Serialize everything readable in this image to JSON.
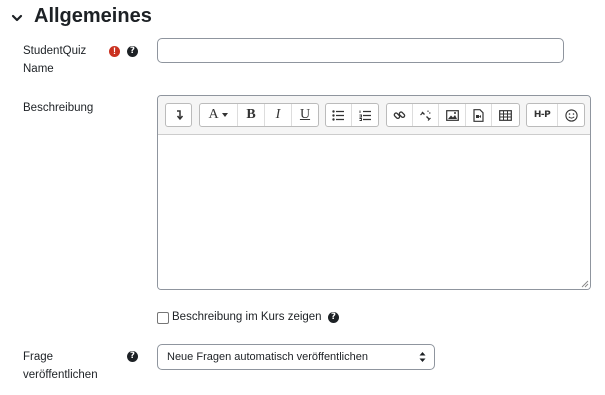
{
  "section": {
    "title": "Allgemeines"
  },
  "fields": {
    "name": {
      "label_line1": "StudentQuiz",
      "label_line2": "Name",
      "value": "",
      "required_symbol": "!",
      "help_symbol": "?"
    },
    "description": {
      "label": "Beschreibung",
      "toolbar": [
        [
          "collapse-icon"
        ],
        [
          "font-style-icon",
          "bold-icon",
          "italic-icon",
          "underline-icon"
        ],
        [
          "unordered-list-icon",
          "ordered-list-icon"
        ],
        [
          "link-icon",
          "unlink-icon",
          "image-icon",
          "media-icon",
          "table-icon"
        ],
        [
          "h5p-icon",
          "emoji-icon"
        ]
      ],
      "bold_glyph": "B",
      "italic_glyph": "I",
      "underline_glyph": "U",
      "font_glyph": "A",
      "h5p_glyph": "H-P"
    },
    "show_description": {
      "label": "Beschreibung im Kurs zeigen",
      "checked": false,
      "help_symbol": "?"
    },
    "publish": {
      "label_line1": "Frage",
      "label_line2": "veröffentlichen",
      "selected": "Neue Fragen automatisch veröffentlichen",
      "help_symbol": "?"
    }
  }
}
